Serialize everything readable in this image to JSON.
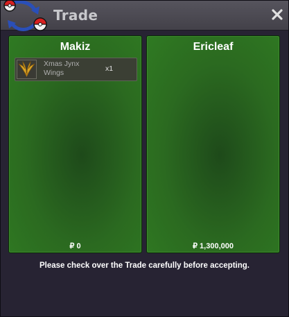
{
  "window": {
    "title": "Trade",
    "close_icon": "close-icon",
    "logo_icon": "pokeball-swap-icon"
  },
  "traders": [
    {
      "name": "Makiz",
      "money": "₽ 0",
      "items": [
        {
          "name": "Xmas Jynx Wings",
          "qty": "x1",
          "icon": "golden-wings-icon"
        }
      ]
    },
    {
      "name": "Ericleaf",
      "money": "₽ 1,300,000",
      "items": []
    }
  ],
  "notice": "Please check over the Trade carefully before accepting.",
  "colors": {
    "panel_green": "#2b6a20",
    "titlebar": "#4d4b54",
    "window_bg": "#272333"
  }
}
